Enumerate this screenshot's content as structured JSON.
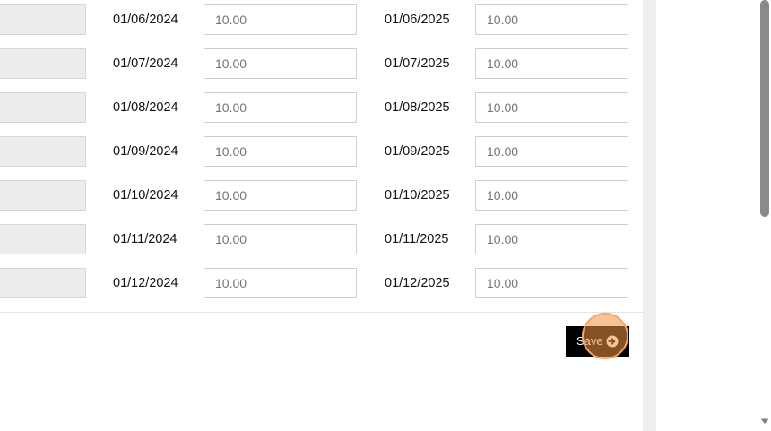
{
  "rates": {
    "rows": [
      {
        "date_a": "01/06/2024",
        "value_a": "10.00",
        "date_b": "01/06/2025",
        "value_b": "10.00"
      },
      {
        "date_a": "01/07/2024",
        "value_a": "10.00",
        "date_b": "01/07/2025",
        "value_b": "10.00"
      },
      {
        "date_a": "01/08/2024",
        "value_a": "10.00",
        "date_b": "01/08/2025",
        "value_b": "10.00"
      },
      {
        "date_a": "01/09/2024",
        "value_a": "10.00",
        "date_b": "01/09/2025",
        "value_b": "10.00"
      },
      {
        "date_a": "01/10/2024",
        "value_a": "10.00",
        "date_b": "01/10/2025",
        "value_b": "10.00"
      },
      {
        "date_a": "01/11/2024",
        "value_a": "10.00",
        "date_b": "01/11/2025",
        "value_b": "10.00"
      },
      {
        "date_a": "01/12/2024",
        "value_a": "10.00",
        "date_b": "01/12/2025",
        "value_b": "10.00"
      }
    ]
  },
  "actions": {
    "save_label": "Save",
    "save_icon": "arrow-circle-right-icon"
  },
  "colors": {
    "save_button_bg": "#000000",
    "click_indicator": "#f39240"
  }
}
